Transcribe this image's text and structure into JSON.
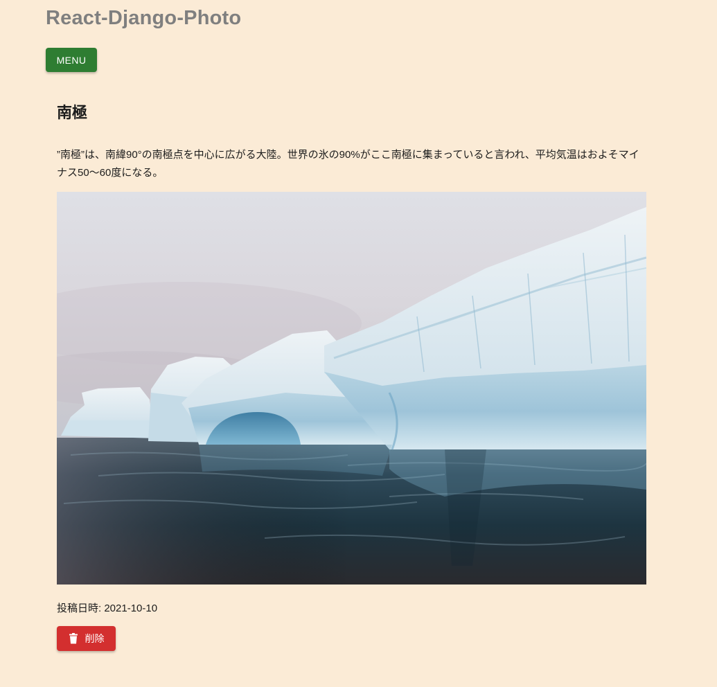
{
  "app": {
    "title": "React-Django-Photo"
  },
  "nav": {
    "menu_label": "MENU"
  },
  "post": {
    "title": "南極",
    "description": "”南極”は、南緯90°の南極点を中心に広がる大陸。世界の氷の90%がここ南極に集まっていると言われ、平均気温はおよそマイナス50〜60度になる。",
    "posted_at": "投稿日時: 2021-10-10",
    "delete_label": "削除"
  },
  "colors": {
    "background": "#fbebd6",
    "menu_button": "#2e7d32",
    "delete_button": "#d32f2f"
  },
  "icons": {
    "delete": "trash-icon"
  }
}
